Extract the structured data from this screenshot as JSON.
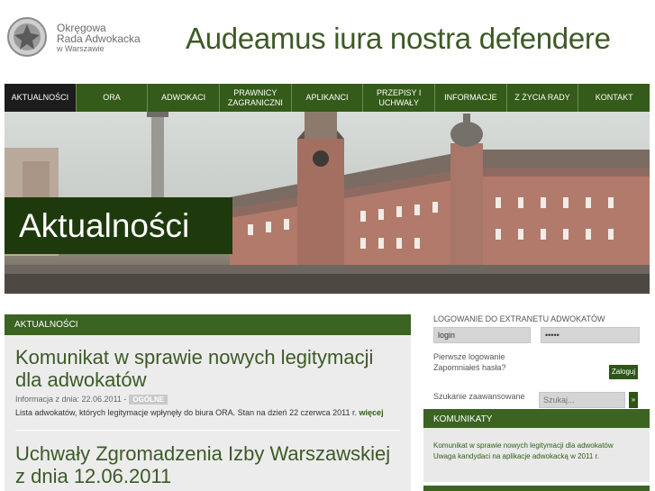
{
  "header": {
    "org_line1": "Okręgowa",
    "org_line2": "Rada Adwokacka",
    "org_line3": "w Warszawie",
    "motto": "Audeamus iura nostra defendere"
  },
  "nav": [
    {
      "label": "AKTUALNOŚCI",
      "active": true
    },
    {
      "label": "ORA"
    },
    {
      "label": "ADWOKACI"
    },
    {
      "label": "PRAWNICY ZAGRANICZNI"
    },
    {
      "label": "APLIKANCI"
    },
    {
      "label": "PRZEPISY I UCHWAŁY"
    },
    {
      "label": "INFORMACJE"
    },
    {
      "label": "Z ŻYCIA RADY"
    },
    {
      "label": "KONTAKT"
    }
  ],
  "banner": {
    "title": "Aktualności"
  },
  "main": {
    "section": "AKTUALNOŚCI",
    "articles": [
      {
        "title": "Komunikat w sprawie nowych legitymacji dla adwokatów",
        "meta": "Informacja z dnia: 22.06.2011",
        "badge": "OGÓLNE",
        "body": "Lista adwokatów, których legitymacje wpłynęły do biura ORA. Stan na dzień 22 czerwca 2011 r.",
        "more": "więcej"
      },
      {
        "title": "Uchwały Zgromadzenia Izby Warszawskiej z dnia 12.06.2011"
      }
    ]
  },
  "login": {
    "title": "LOGOWANIE DO EXTRANETU ADWOKATÓW",
    "login_value": "login",
    "password_value": "•••••",
    "first_login": "Pierwsze logowanie",
    "forgot": "Zapomniałeś hasła?",
    "submit": "Zaloguj"
  },
  "search": {
    "advanced": "Szukanie zaawansowane",
    "placeholder": "Szukaj...",
    "button": "»"
  },
  "announcements": {
    "title": "KOMUNIKATY",
    "items": [
      "Komunikat w sprawie nowych legitymacji dla adwokatów",
      "Uwaga kandydaci na aplikacje adwokacką w 2011 r."
    ]
  },
  "colors": {
    "primary_green": "#3b6322",
    "nav_green": "#345b19",
    "nav_active": "#1c1c1c",
    "title_green": "#3d5a26"
  }
}
